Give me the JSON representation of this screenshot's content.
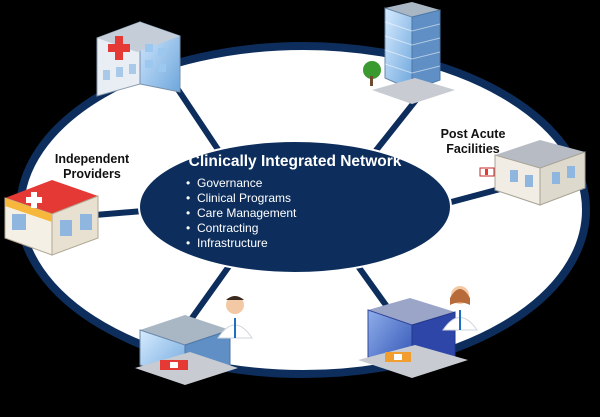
{
  "hub": {
    "title": "Clinically Integrated Network",
    "items": [
      "Governance",
      "Clinical Programs",
      "Care Management",
      "Contracting",
      "Infrastructure"
    ]
  },
  "labels": {
    "independent_providers": [
      "Independent",
      "Providers"
    ],
    "post_acute": [
      "Post Acute",
      "Facilities"
    ]
  },
  "nodes": [
    "hospital-icon",
    "office-tower-icon",
    "clinic-icon",
    "retail-clinic-icon",
    "hospital-with-doctor-icon",
    "medical-center-with-doctor-icon"
  ],
  "colors": {
    "ring": "#0d2e5c",
    "hub": "#0d2e5c",
    "ring_fill": "#ffffff",
    "background": "#000000"
  }
}
